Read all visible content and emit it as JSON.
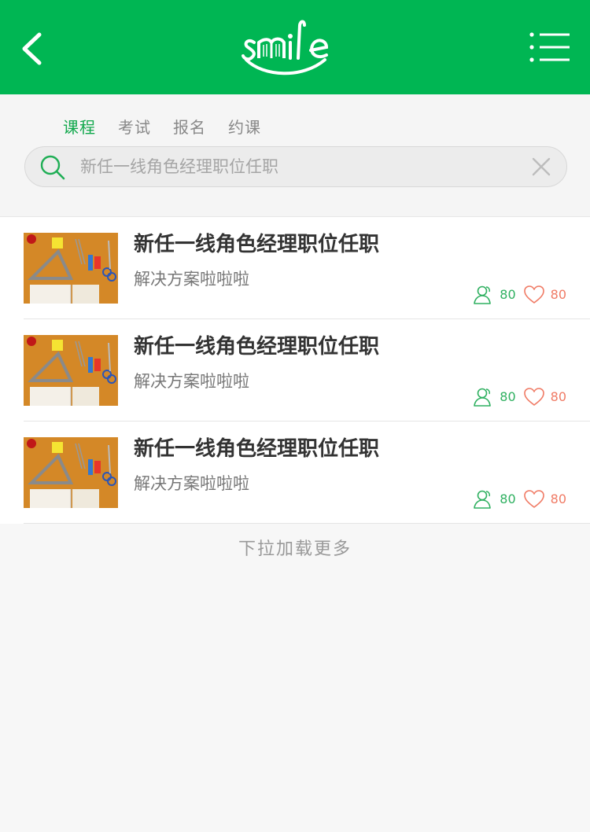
{
  "header": {
    "logo_text": "smile"
  },
  "tabs": [
    {
      "label": "课程",
      "active": true
    },
    {
      "label": "考试",
      "active": false
    },
    {
      "label": "报名",
      "active": false
    },
    {
      "label": "约课",
      "active": false
    }
  ],
  "search": {
    "placeholder": "新任一线角色经理职位任职"
  },
  "items": [
    {
      "title": "新任一线角色经理职位任职",
      "subtitle": "解决方案啦啦啦",
      "users": "80",
      "likes": "80"
    },
    {
      "title": "新任一线角色经理职位任职",
      "subtitle": "解决方案啦啦啦",
      "users": "80",
      "likes": "80"
    },
    {
      "title": "新任一线角色经理职位任职",
      "subtitle": "解决方案啦啦啦",
      "users": "80",
      "likes": "80"
    }
  ],
  "footer": {
    "load_more": "下拉加载更多"
  },
  "colors": {
    "brand": "#00b653",
    "accent_green": "#2fb060",
    "like_red": "#f07a64"
  },
  "icons": [
    "back-arrow-icon",
    "menu-list-icon",
    "search-icon",
    "close-icon",
    "users-icon",
    "heart-icon"
  ]
}
